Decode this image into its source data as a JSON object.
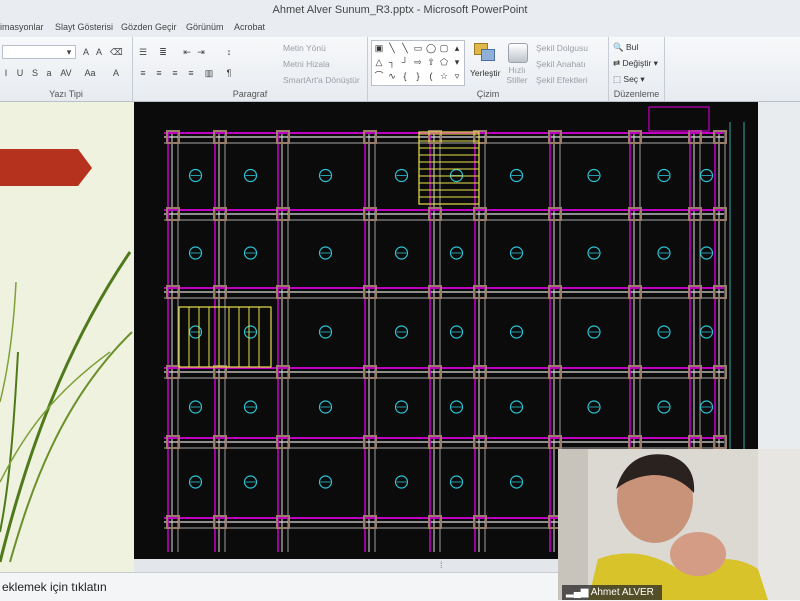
{
  "window": {
    "title": "Ahmet Alver Sunum_R3.pptx  -  Microsoft PowerPoint"
  },
  "tabs": [
    "imasyonlar",
    "Slayt Gösterisi",
    "Gözden Geçir",
    "Görünüm",
    "Acrobat"
  ],
  "ribbon": {
    "font_group": "Yazı Tipi",
    "paragraph_group": "Paragraf",
    "drawing_group": "Çizim",
    "editing_group": "Düzenleme",
    "text_direction": "Metin Yönü",
    "align_text": "Metni Hizala",
    "smartart": "SmartArt'a Dönüştür",
    "arrange": "Yerleştir",
    "quick_styles": "Hızlı Stiller",
    "shape_fill": "Şekil Dolgusu",
    "shape_outline": "Şekil Anahatı",
    "shape_effects": "Şekil Efektleri",
    "find": "Bul",
    "replace": "Değiştir",
    "select": "Seç"
  },
  "notes": {
    "placeholder": "eklemek için tıklatın"
  },
  "webcam": {
    "name": "Ahmet ALVER"
  },
  "colors": {
    "slide_bg": "#0b0b0b",
    "magenta": "#c000c0",
    "cyan": "#2ec4d6",
    "yellow": "#e8e04a",
    "arrow": "#b5321f",
    "panel": "#eef2df"
  }
}
